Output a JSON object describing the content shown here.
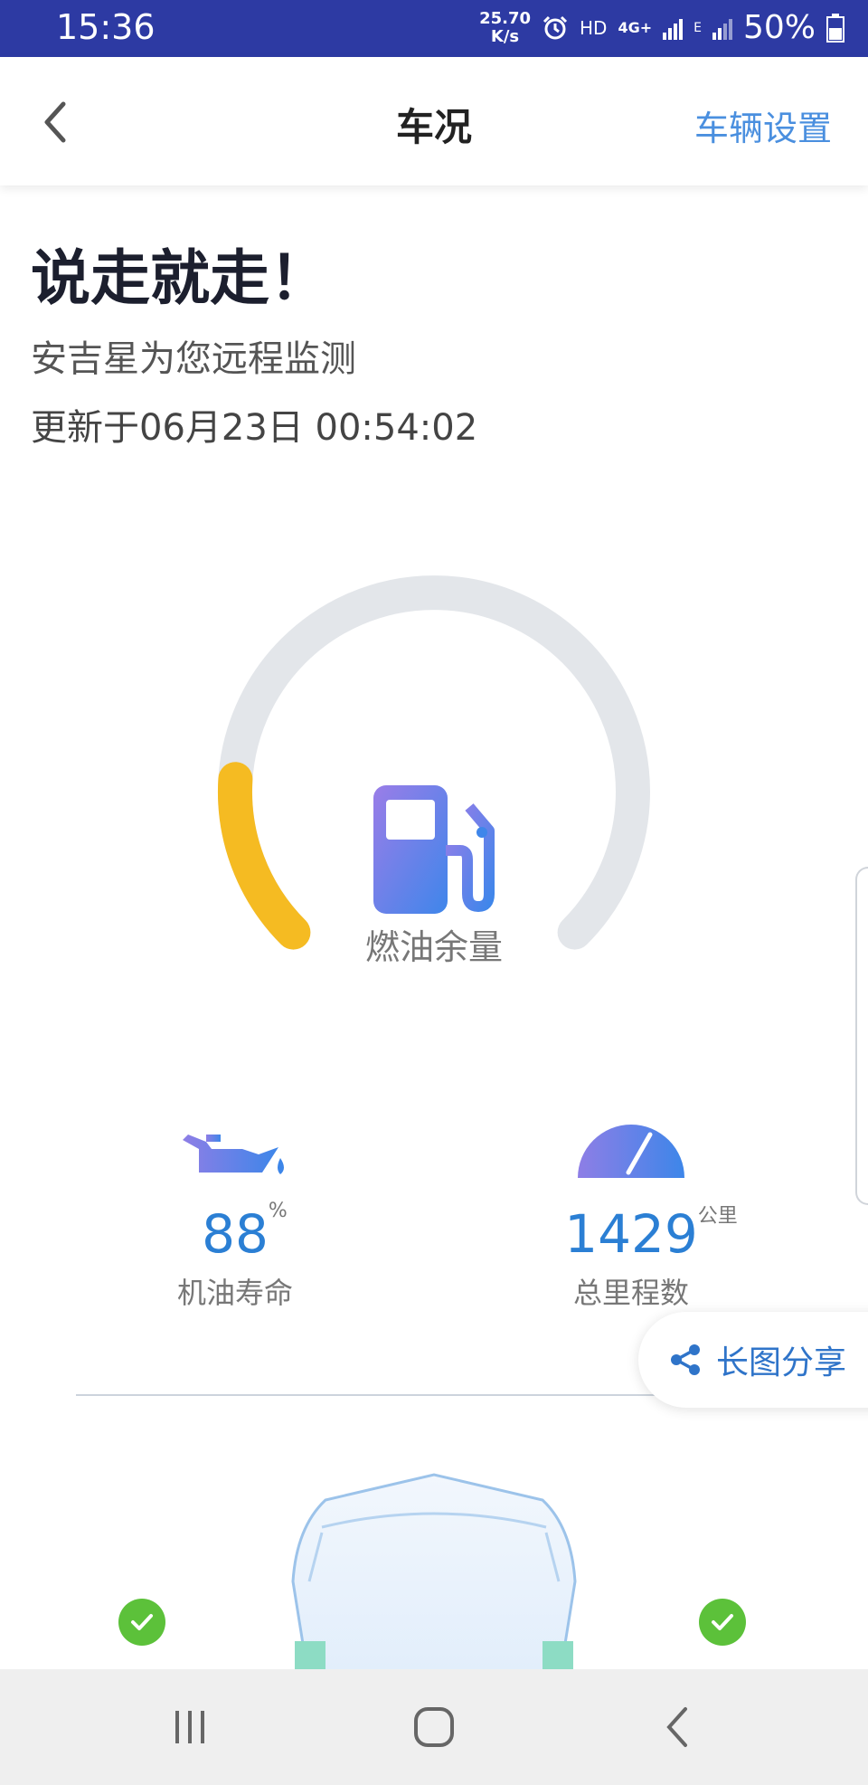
{
  "status_bar": {
    "time": "15:36",
    "net_speed_value": "25.70",
    "net_speed_unit": "K/s",
    "hd_label": "HD",
    "network_label": "4G+",
    "network_label_2": "E",
    "battery": "50%"
  },
  "app_bar": {
    "title": "车况",
    "settings_label": "车辆设置"
  },
  "hero": {
    "title": "说走就走！",
    "subtitle": "安吉星为您远程监测",
    "updated": "更新于06月23日 00:54:02"
  },
  "fuel_gauge": {
    "label": "燃油余量",
    "level_fraction": 0.18,
    "fill_color": "#f5bb22",
    "track_color": "#e3e6ea",
    "icon": "fuel-pump-icon"
  },
  "stats": {
    "oil_life": {
      "value": "88",
      "unit": "%",
      "label": "机油寿命",
      "icon": "oil-can-icon"
    },
    "mileage": {
      "value": "1429",
      "unit": "公里",
      "label": "总里程数",
      "icon": "speedometer-icon"
    }
  },
  "share": {
    "label": "长图分享",
    "icon": "share-icon"
  },
  "tire_status": {
    "front_left": "ok",
    "front_right": "ok",
    "status_color": "#5cc13a"
  },
  "colors": {
    "accent_blue": "#2b7fd4",
    "status_bar_bg": "#2d3aa3"
  }
}
